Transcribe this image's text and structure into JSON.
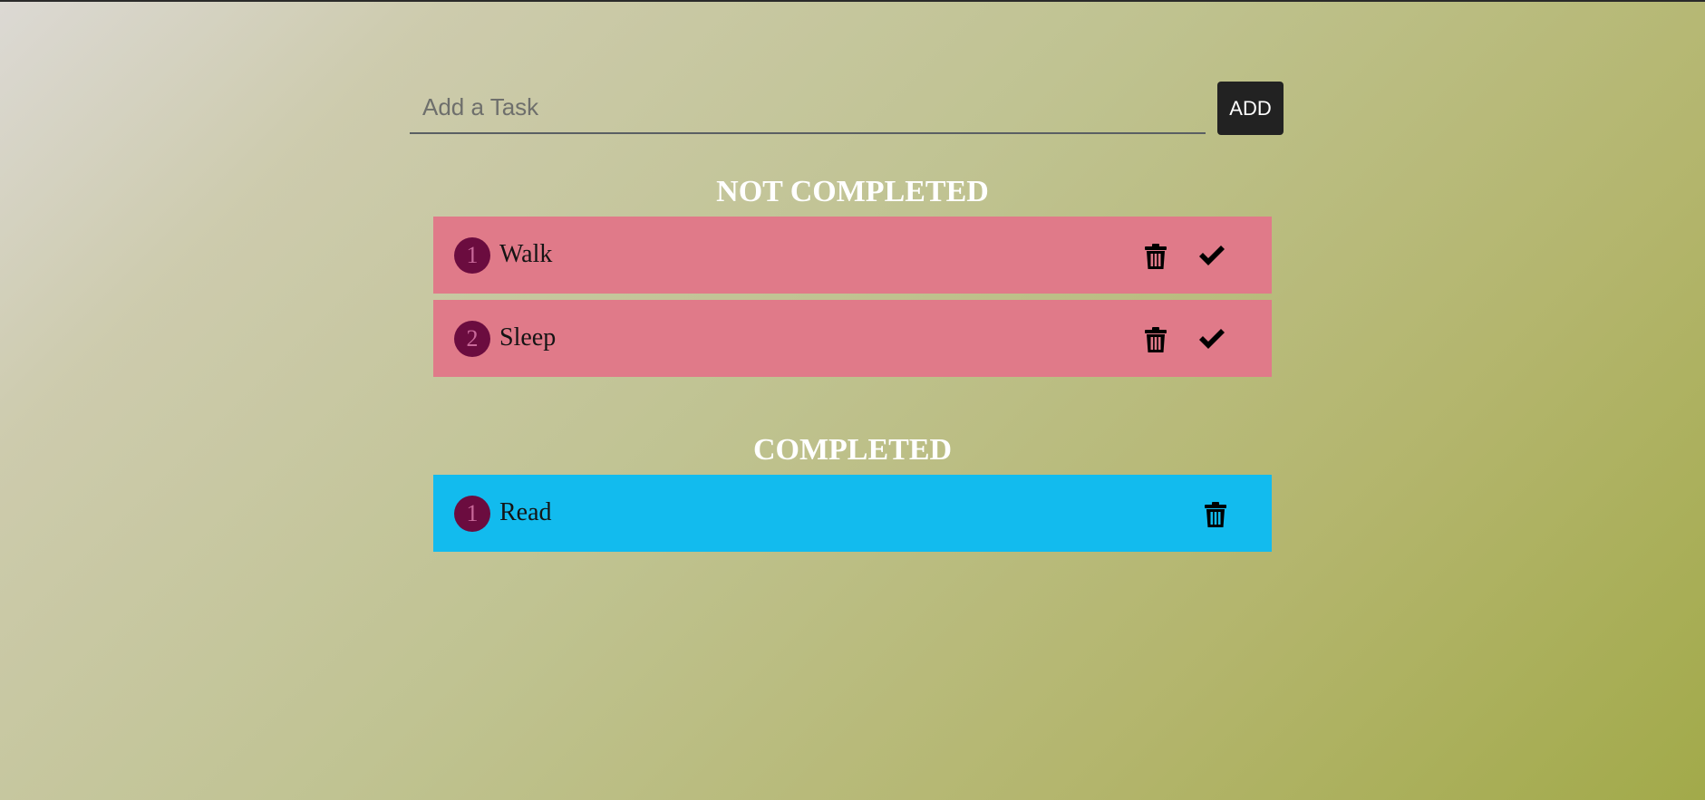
{
  "input": {
    "placeholder": "Add a Task",
    "value": ""
  },
  "add_button_label": "ADD",
  "sections": {
    "not_completed_title": "NOT COMPLETED",
    "completed_title": "COMPLETED"
  },
  "not_completed_tasks": [
    {
      "number": "1",
      "text": "Walk"
    },
    {
      "number": "2",
      "text": "Sleep"
    }
  ],
  "completed_tasks": [
    {
      "number": "1",
      "text": "Read"
    }
  ],
  "colors": {
    "pending_row": "#e07a89",
    "completed_row": "#12bbee",
    "number_badge": "#6b0c3f",
    "add_button": "#222222"
  },
  "icons": {
    "delete": "trash-icon",
    "complete": "check-icon"
  }
}
